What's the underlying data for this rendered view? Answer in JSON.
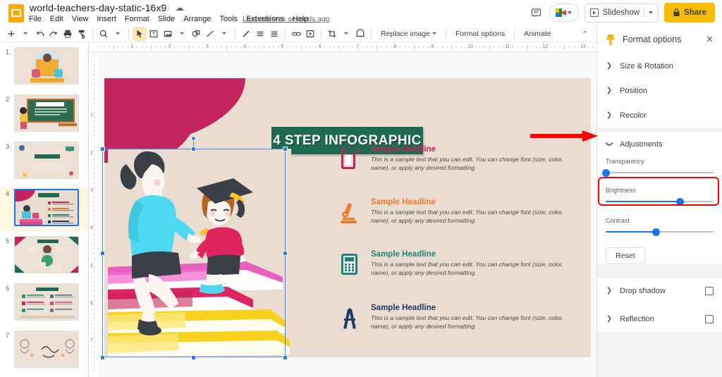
{
  "app": {
    "doc_title": "world-teachers-day-static-16x9",
    "last_edit": "Last edit was seconds ago",
    "title_icons": [
      "star-icon",
      "move-to-folder-icon",
      "cloud-saved-icon"
    ],
    "menus": [
      "File",
      "Edit",
      "View",
      "Insert",
      "Format",
      "Slide",
      "Arrange",
      "Tools",
      "Extensions",
      "Help"
    ],
    "slideshow_label": "Slideshow",
    "share_label": "Share"
  },
  "toolbar": {
    "items": [
      {
        "name": "new-slide-button",
        "glyph": "+"
      },
      {
        "name": "new-slide-dropdown",
        "glyph": "▾"
      },
      {
        "name": "undo-button",
        "glyph": "↶"
      },
      {
        "name": "redo-button",
        "glyph": "↷"
      },
      {
        "name": "print-button",
        "glyph": "🖶"
      },
      {
        "name": "paint-format-button",
        "glyph": "⌁"
      },
      {
        "name": "zoom-button",
        "glyph": "⌕"
      },
      {
        "name": "zoom-dropdown",
        "glyph": "▾"
      },
      {
        "name": "select-tool-button",
        "glyph": "➚"
      },
      {
        "name": "textbox-button",
        "glyph": "T"
      },
      {
        "name": "insert-image-button",
        "glyph": "▭"
      },
      {
        "name": "insert-image-dropdown",
        "glyph": "▾"
      },
      {
        "name": "shape-button",
        "glyph": "◓"
      },
      {
        "name": "line-button",
        "glyph": "╲"
      },
      {
        "name": "line-dropdown",
        "glyph": "▾"
      },
      {
        "name": "pen-button",
        "glyph": "✎"
      },
      {
        "name": "align-button",
        "glyph": "≡"
      },
      {
        "name": "line-spacing-button",
        "glyph": "⁝"
      },
      {
        "name": "insert-link-button",
        "glyph": "⛓"
      },
      {
        "name": "insert-comment-button",
        "glyph": "▣"
      },
      {
        "name": "crop-button",
        "glyph": "⛶"
      },
      {
        "name": "crop-dropdown",
        "glyph": "▾"
      },
      {
        "name": "mask-button",
        "glyph": "⬓"
      }
    ],
    "replace_image": "Replace image",
    "format_options": "Format options",
    "animate": "Animate"
  },
  "filmstrip": {
    "slides": [
      {
        "num": "1",
        "name": "slide-thumb-1"
      },
      {
        "num": "2",
        "name": "slide-thumb-2"
      },
      {
        "num": "3",
        "name": "slide-thumb-3"
      },
      {
        "num": "4",
        "name": "slide-thumb-4",
        "active": true
      },
      {
        "num": "5",
        "name": "slide-thumb-5"
      },
      {
        "num": "6",
        "name": "slide-thumb-6"
      },
      {
        "num": "7",
        "name": "slide-thumb-7"
      }
    ]
  },
  "rulers": {
    "horizontal_ticks": [
      "1",
      "2",
      "3",
      "4",
      "5",
      "6",
      "7",
      "8",
      "9",
      "10",
      "11",
      "12",
      "13"
    ],
    "vertical_ticks": [
      "1",
      "2",
      "3",
      "4",
      "5",
      "6",
      "7"
    ]
  },
  "slide": {
    "title": "4 STEP INFOGRAPHIC",
    "title_bg": "#1F6A52",
    "background": "#EADCD0",
    "blob_color": "#C4245E",
    "steps": [
      {
        "icon": "beaker-icon",
        "color": "#C4245E",
        "headline": "Sample Headline",
        "body": "This is a sample text that you can edit. You can change font (size, color, name), or apply any desired formatting."
      },
      {
        "icon": "microscope-icon",
        "color": "#F07B2B",
        "headline": "Sample Headline",
        "body": "This is a sample text that you can edit. You can change font (size, color, name), or apply any desired formatting."
      },
      {
        "icon": "calculator-icon",
        "color": "#1E8577",
        "headline": "Sample Headline",
        "body": "This is a sample text that you can edit. You can change font (size, color, name), or apply any desired formatting."
      },
      {
        "icon": "compass-icon",
        "color": "#1B3B63",
        "headline": "Sample Headline",
        "body": "This is a sample text that you can edit. You can change font (size, color, name), or apply any desired formatting."
      }
    ]
  },
  "panel": {
    "title": "Format options",
    "close_label": "✕",
    "sections": [
      {
        "label": "Size & Rotation",
        "expanded": false
      },
      {
        "label": "Position",
        "expanded": false
      },
      {
        "label": "Recolor",
        "expanded": false
      }
    ],
    "adjustments": {
      "label": "Adjustments",
      "expanded": true,
      "sliders": [
        {
          "label": "Transparency",
          "value": 0
        },
        {
          "label": "Brightness",
          "value": 69,
          "highlighted": true
        },
        {
          "label": "Contrast",
          "value": 47
        }
      ],
      "reset_label": "Reset"
    },
    "effects": [
      {
        "label": "Drop shadow",
        "checked": false
      },
      {
        "label": "Reflection",
        "checked": false
      }
    ],
    "highlight_color": "#ff0000",
    "accent_color": "#1a73e8"
  }
}
